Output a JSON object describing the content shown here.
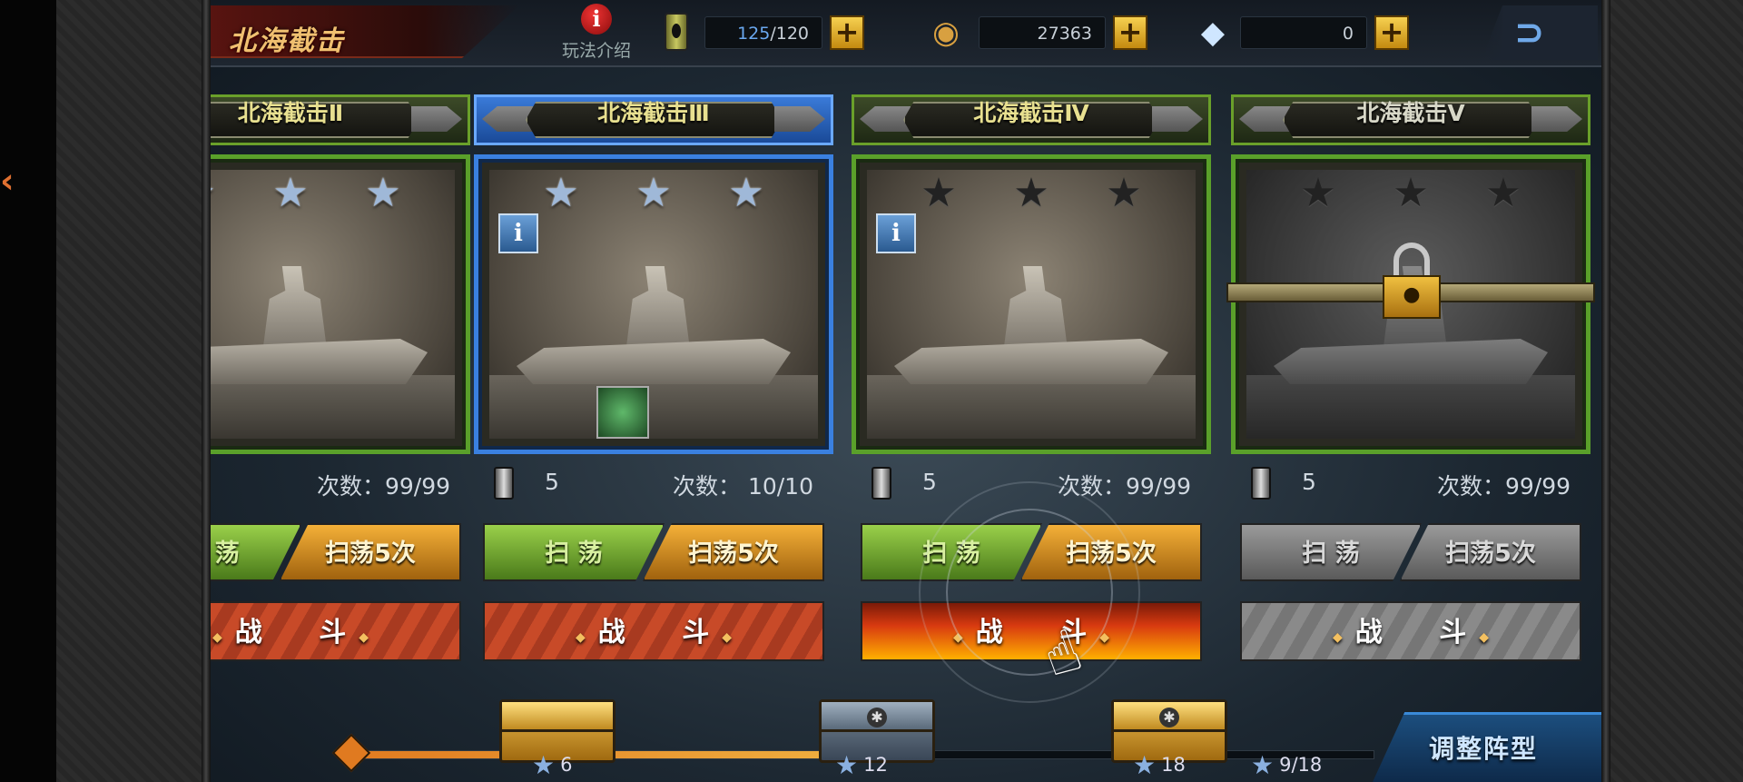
{
  "header": {
    "title": "北海截击",
    "info_label": "玩法介绍",
    "fuel": {
      "current": "125",
      "sep_max": "/120"
    },
    "coins": "27363",
    "gems": "0",
    "plus": "+",
    "back_glyph": "⊃"
  },
  "stages": [
    {
      "name": "北海截击Ⅱ",
      "stars": 3,
      "stars_earned": 3,
      "cost": "",
      "count_label": "次数：99/99",
      "sweep": "扫 荡",
      "sweep5": "扫荡5次",
      "fight": "战 斗",
      "state": "cleared"
    },
    {
      "name": "北海截击Ⅲ",
      "stars": 3,
      "stars_earned": 3,
      "cost": "5",
      "count_label": "次数： 10/10",
      "sweep": "扫 荡",
      "sweep5": "扫荡5次",
      "fight": "战 斗",
      "state": "selected"
    },
    {
      "name": "北海截击Ⅳ",
      "stars": 3,
      "stars_earned": 0,
      "cost": "5",
      "count_label": "次数：99/99",
      "sweep": "扫 荡",
      "sweep5": "扫荡5次",
      "fight": "战 斗",
      "state": "available"
    },
    {
      "name": "北海截击Ⅴ",
      "stars": 3,
      "stars_earned": 0,
      "cost": "5",
      "count_label": "次数：99/99",
      "sweep": "扫 荡",
      "sweep5": "扫荡5次",
      "fight": "战 斗",
      "state": "locked"
    }
  ],
  "rewards": {
    "milestones": [
      {
        "stars": "6",
        "chest": "gold"
      },
      {
        "stars": "12",
        "chest": "blue"
      },
      {
        "stars": "18",
        "chest": "gold"
      }
    ],
    "progress_label": "9/18",
    "progress_fraction": 0.5
  },
  "adjust_label": "调整阵型",
  "icons": {
    "info": "i",
    "star": "★",
    "lock": "lock-icon",
    "hand": "☝"
  },
  "colors": {
    "accent_gold": "#f0c050",
    "selected_blue": "#3a80e0",
    "cleared_green": "#5aa02a"
  }
}
